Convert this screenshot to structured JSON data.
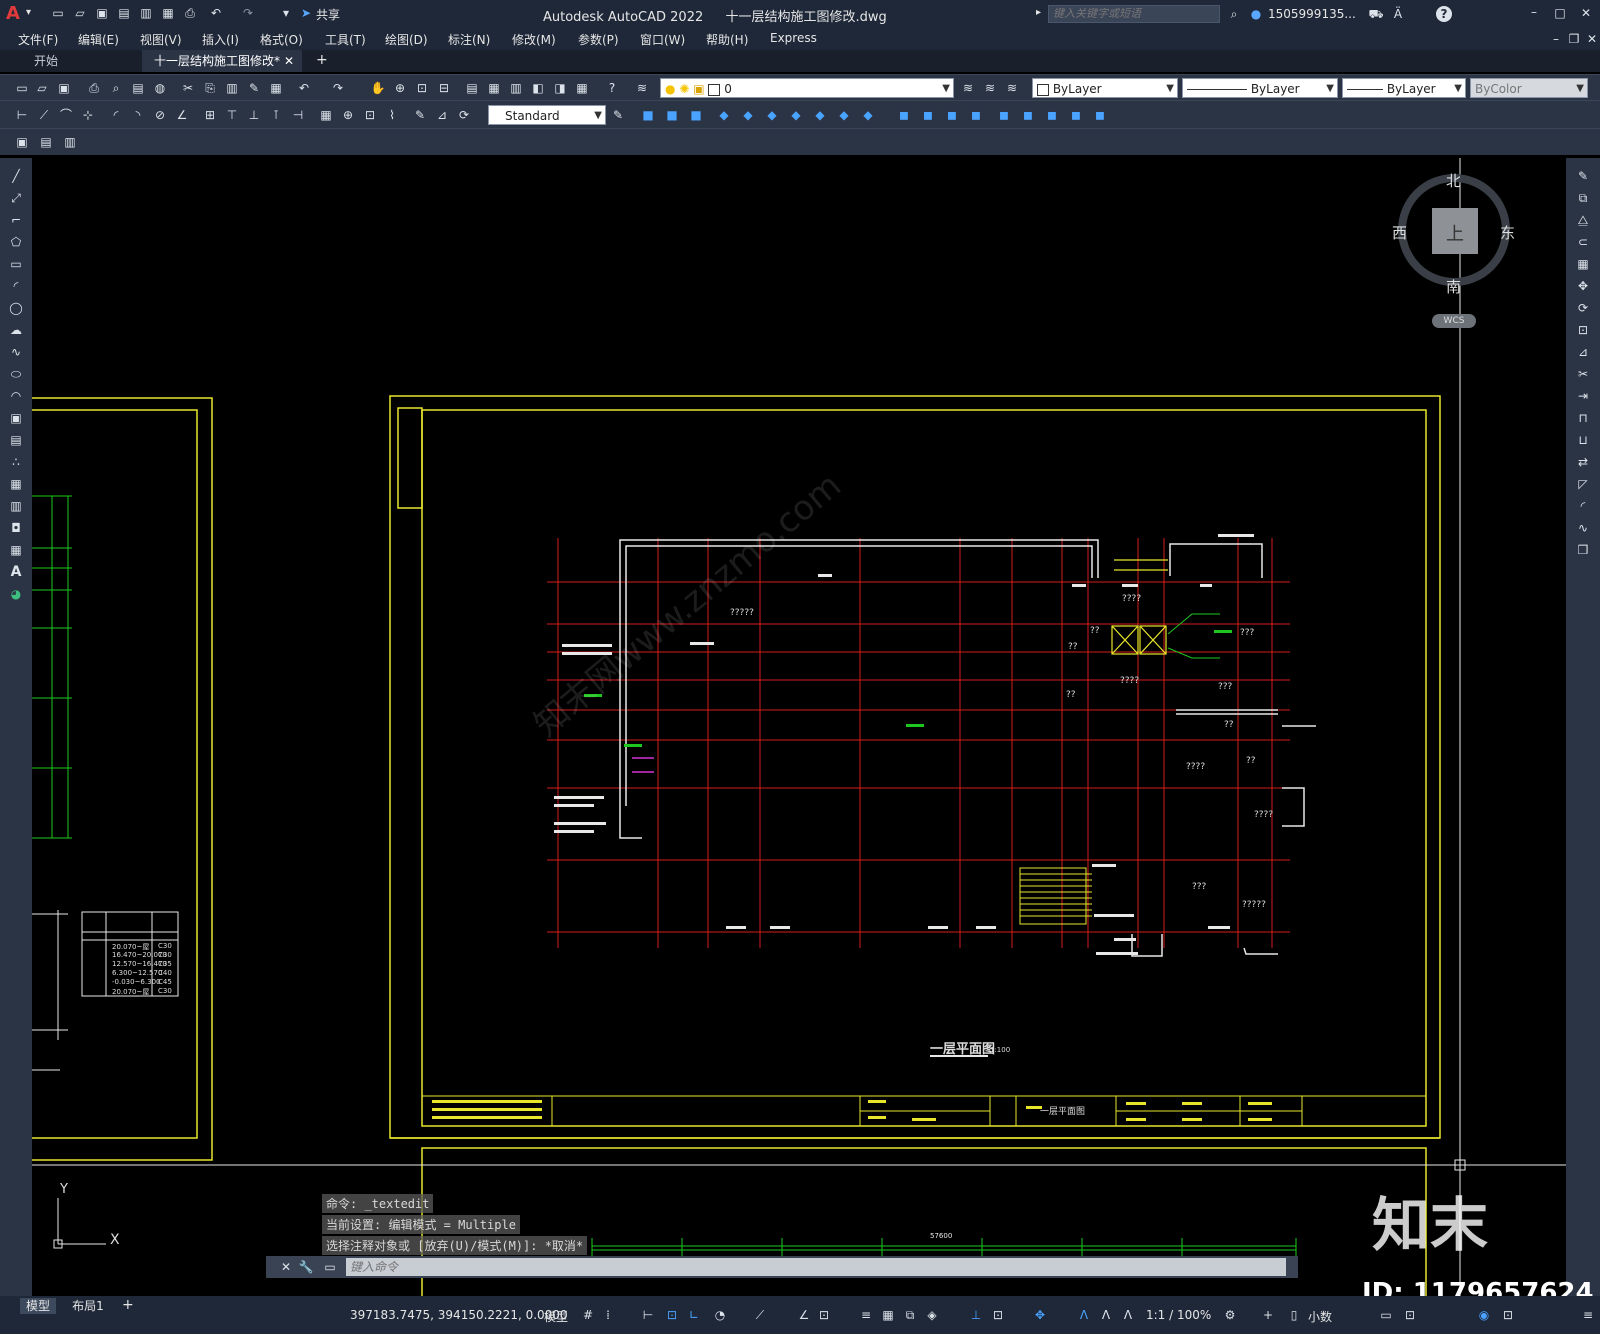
{
  "app": {
    "title": "Autodesk AutoCAD 2022",
    "file": "十一层结构施工图修改.dwg",
    "share_label": "共享",
    "search_placeholder": "键入关键字或短语",
    "user": "1505999135..."
  },
  "menu": [
    "文件(F)",
    "编辑(E)",
    "视图(V)",
    "插入(I)",
    "格式(O)",
    "工具(T)",
    "绘图(D)",
    "标注(N)",
    "修改(M)",
    "参数(P)",
    "窗口(W)",
    "帮助(H)",
    "Express"
  ],
  "doc_tabs": {
    "start": "开始",
    "active": "十一层结构施工图修改*",
    "add": "+"
  },
  "props": {
    "layer": "0",
    "color": "ByLayer",
    "linetype": "ByLayer",
    "lineweight": "ByLayer",
    "plotstyle": "ByColor",
    "textstyle": "Standard"
  },
  "viewcube": {
    "north": "北",
    "south": "南",
    "east": "东",
    "west": "西",
    "top": "上",
    "wcs": "WCS"
  },
  "ucs": {
    "x": "X",
    "y": "Y"
  },
  "command_history": [
    "命令: _textedit",
    "当前设置: 编辑模式 = Multiple",
    "选择注释对象或 [放弃(U)/模式(M)]: *取消*"
  ],
  "command_placeholder": "键入命令",
  "layout_tabs": [
    "模型",
    "布局1"
  ],
  "status": {
    "coords": "397183.7475, 394150.2221, 0.0000",
    "space": "模型",
    "scale": "1:1 / 100%",
    "units": "小数"
  },
  "drawing": {
    "plan_title": "一层平面图",
    "plan_scale": "1:100",
    "table_rows": [
      [
        "20.070~屋",
        "C30"
      ],
      [
        "16.470~20.070",
        "C30"
      ],
      [
        "12.570~16.470",
        "C35"
      ],
      [
        "6.300~12.570",
        "C40"
      ],
      [
        "-0.030~6.300",
        "C45"
      ],
      [
        "20.070~屋",
        "C30"
      ]
    ],
    "titleblock_name": "一层平面图",
    "dim_total": "57600",
    "labels_q": [
      "?????",
      "????",
      "??",
      "???",
      "??",
      "????",
      "???",
      "????",
      "??",
      "????",
      "??",
      "???",
      "?????",
      "??"
    ]
  },
  "watermark": {
    "site": "知末网www.znzmo.com",
    "logo": "知末",
    "id": "ID: 1179657624"
  },
  "colors": {
    "yellow": "#e8e62a",
    "red": "#d61d1d",
    "green": "#1ec71e",
    "white": "#e8e8e8",
    "ui_bg": "#2b3445"
  }
}
